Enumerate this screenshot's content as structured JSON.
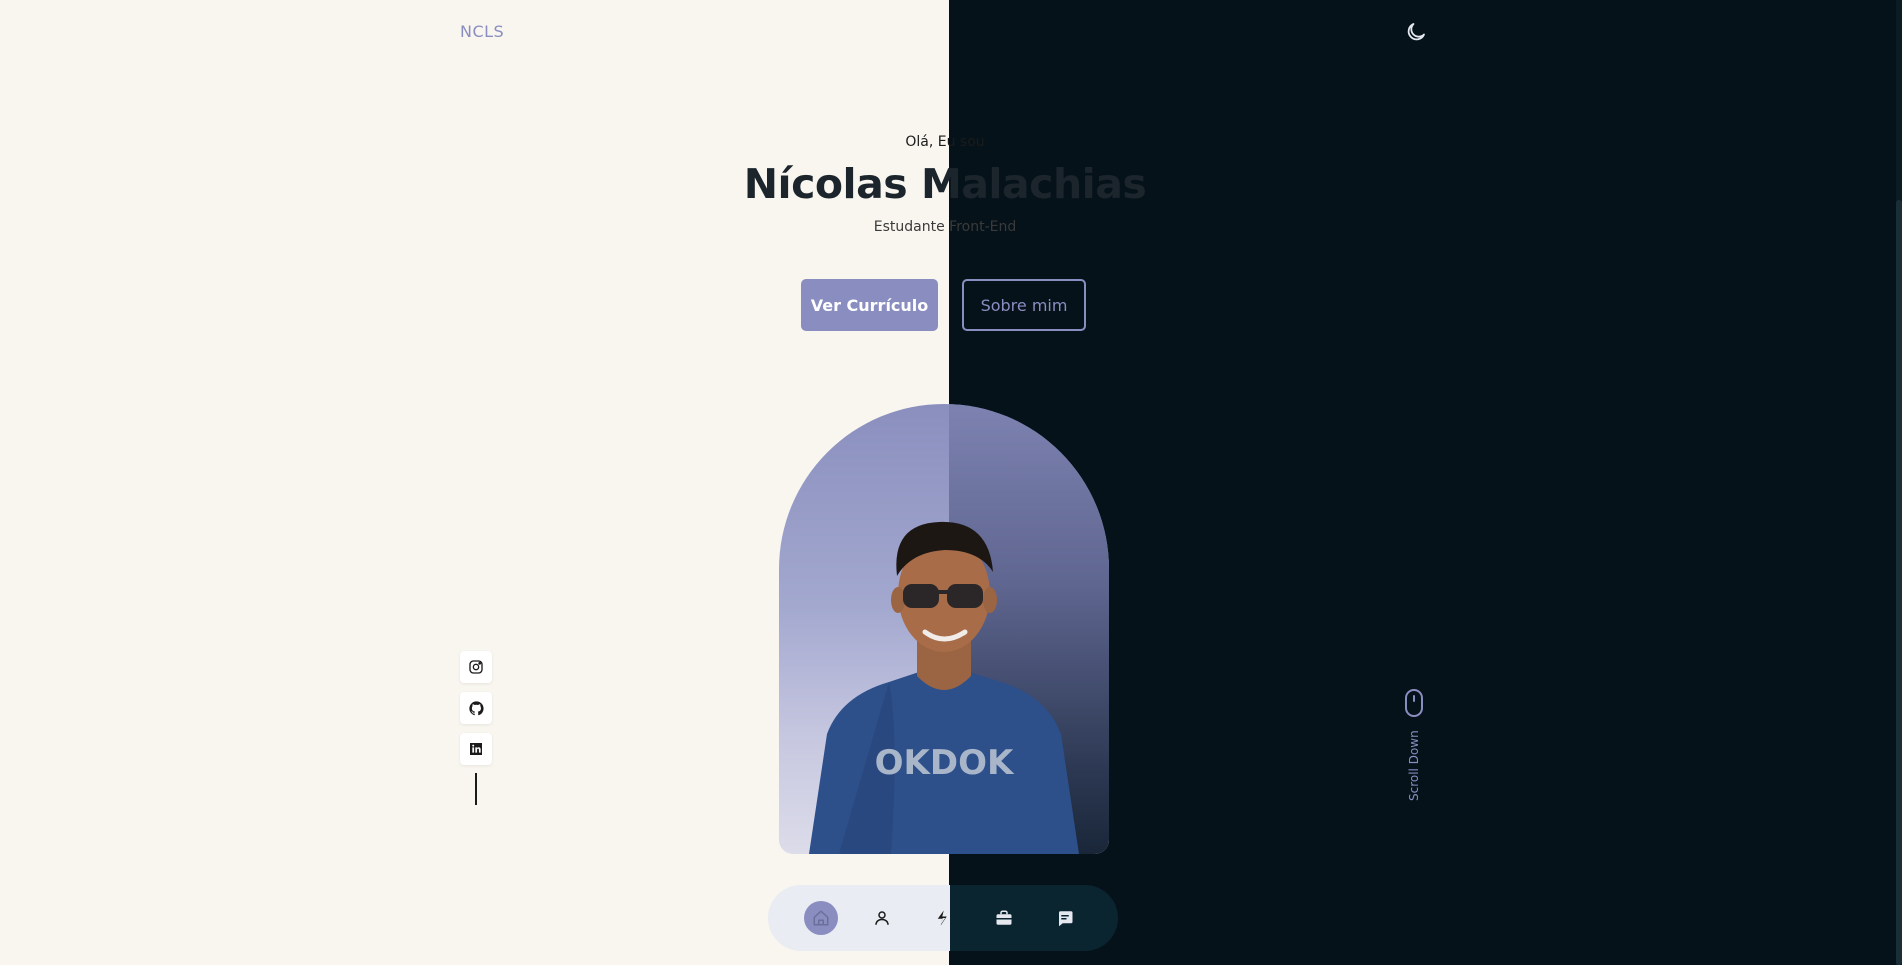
{
  "header": {
    "logo": "NCLS",
    "theme_toggle_icon": "moon-icon"
  },
  "hero": {
    "greeting": "Olá, Eu sou",
    "name": "Nícolas Malachias",
    "role": "Estudante Front-End",
    "primary_button": "Ver Currículo",
    "secondary_button": "Sobre mim",
    "photo_shirt_text": "OKDOK"
  },
  "socials": {
    "items": [
      {
        "icon": "instagram-icon"
      },
      {
        "icon": "github-icon"
      },
      {
        "icon": "linkedin-icon"
      }
    ]
  },
  "scroll": {
    "label": "Scroll Down",
    "icon": "mouse-icon"
  },
  "bottom_nav": {
    "items": [
      {
        "icon": "home-icon",
        "active": true
      },
      {
        "icon": "user-icon",
        "active": false
      },
      {
        "icon": "lightning-icon",
        "active": false
      },
      {
        "icon": "briefcase-icon",
        "active": false
      },
      {
        "icon": "message-icon",
        "active": false
      }
    ]
  },
  "colors": {
    "accent": "#8a8dc0",
    "light_bg": "#f9f6f0",
    "dark_bg": "#05121a",
    "title": "#1c252c"
  }
}
